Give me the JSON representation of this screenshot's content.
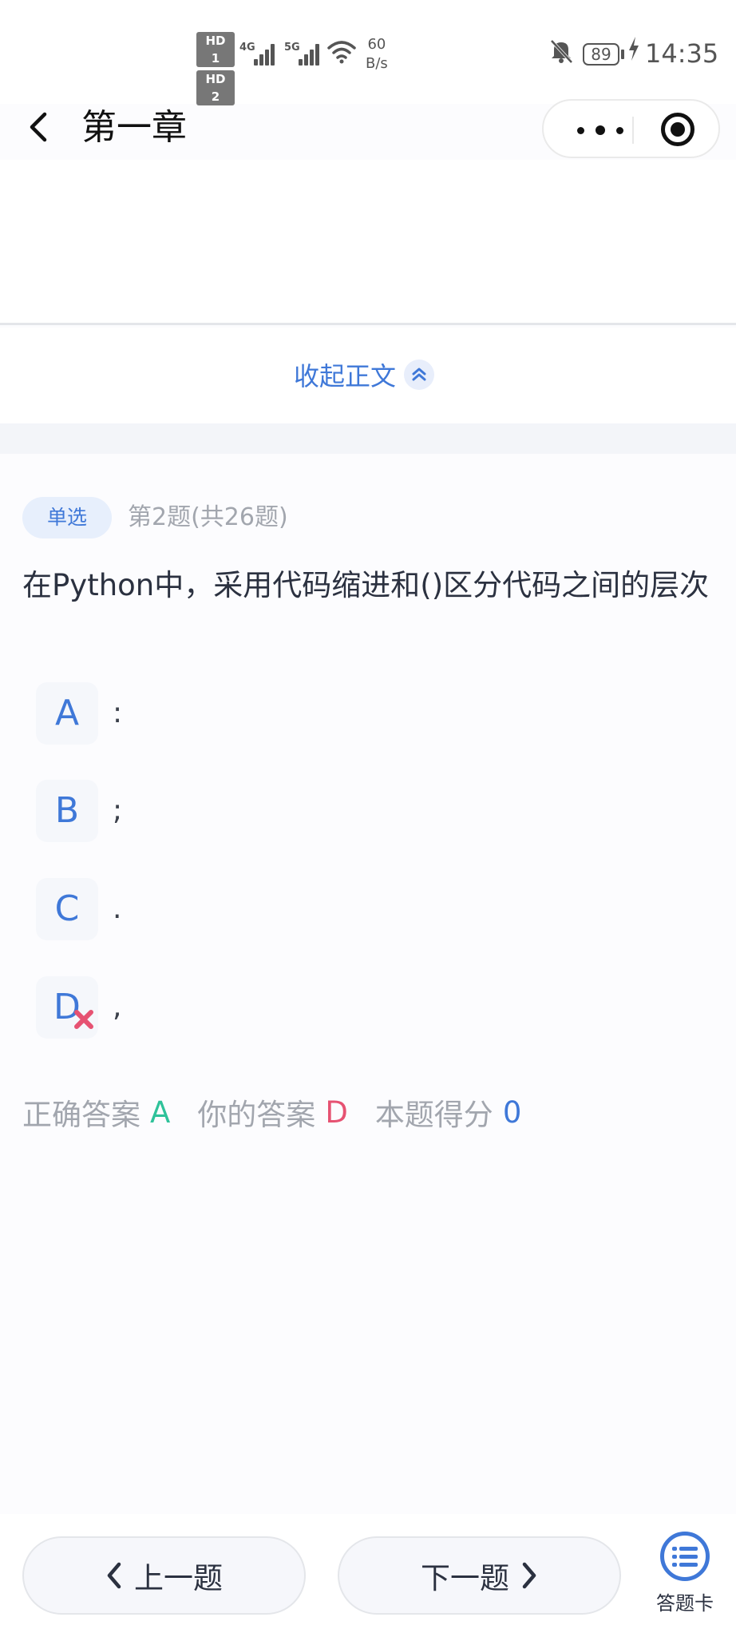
{
  "status_bar": {
    "hd1": "HD 1",
    "hd2": "HD 2",
    "net1": "4G",
    "net2": "5G",
    "speed_value": "60",
    "speed_unit": "B/s",
    "battery": "89",
    "time": "14:35",
    "icons": [
      "wifi-icon",
      "bell-off-icon",
      "battery-icon",
      "charging-icon"
    ]
  },
  "nav": {
    "title": "第一章"
  },
  "collapse": {
    "label": "收起正文"
  },
  "question": {
    "type": "单选",
    "index": "第2题(共26题)",
    "text": "在Python中，采用代码缩进和()区分代码之间的层次",
    "options": [
      {
        "letter": "A",
        "text": ":",
        "wrong": false
      },
      {
        "letter": "B",
        "text": ";",
        "wrong": false
      },
      {
        "letter": "C",
        "text": ".",
        "wrong": false
      },
      {
        "letter": "D",
        "text": ",",
        "wrong": true
      }
    ]
  },
  "result": {
    "correct_label": "正确答案",
    "correct_value": "A",
    "user_label": "你的答案",
    "user_value": "D",
    "score_label": "本题得分",
    "score_value": "0"
  },
  "bottom": {
    "prev_label": "上一题",
    "next_label": "下一题",
    "card_label": "答题卡"
  },
  "colors": {
    "accent": "#3f78d8",
    "correct": "#2fc29a",
    "wrong": "#e65272",
    "muted": "#a2a6ae"
  }
}
